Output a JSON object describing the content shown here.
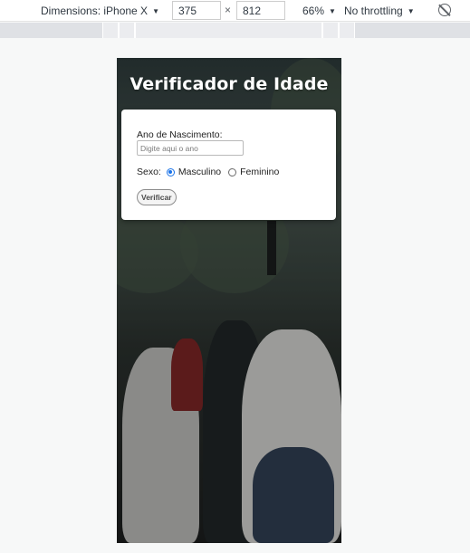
{
  "devtools": {
    "device_label": "Dimensions: iPhone X",
    "width": "375",
    "height": "812",
    "zoom": "66%",
    "throttling": "No throttling"
  },
  "page": {
    "title": "Verificador de Idade",
    "form": {
      "year_label": "Ano de Nascimento:",
      "year_placeholder": "Digite aqui o ano",
      "year_value": "",
      "sex_label": "Sexo:",
      "options": [
        {
          "label": "Masculino",
          "checked": true
        },
        {
          "label": "Feminino",
          "checked": false
        }
      ],
      "button_label": "Verificar"
    }
  }
}
